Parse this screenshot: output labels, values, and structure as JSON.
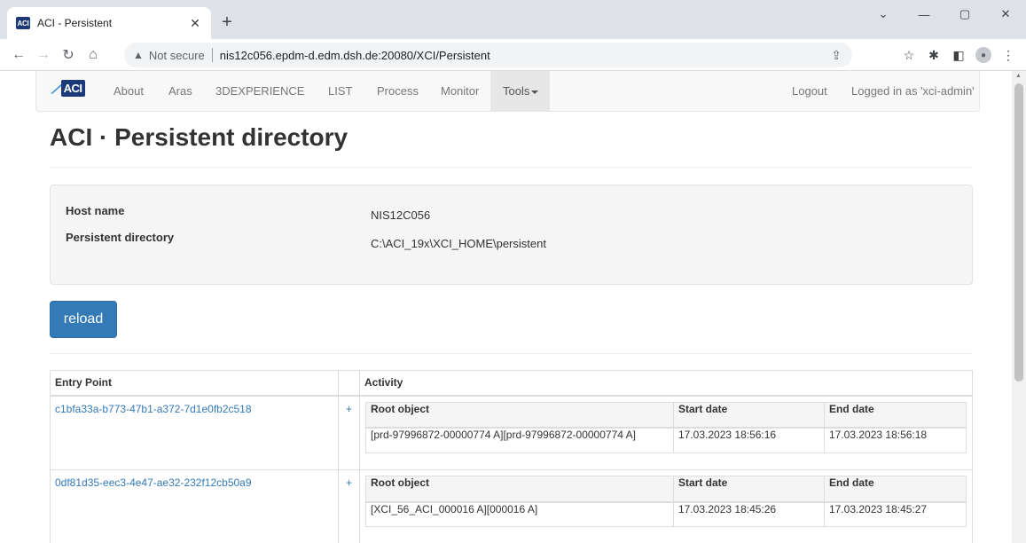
{
  "browser": {
    "tab_title": "ACI - Persistent",
    "favicon_text": "ACI",
    "security_label": "Not secure",
    "url": "nis12c056.epdm-d.edm.dsh.de:20080/XCI/Persistent"
  },
  "navbar": {
    "brand": "ACI",
    "links": [
      "About",
      "Aras",
      "3DEXPERIENCE",
      "LIST",
      "Process",
      "Monitor"
    ],
    "tools_label": "Tools",
    "logout_label": "Logout",
    "logged_in": "Logged in as 'xci-admin'"
  },
  "page": {
    "title_bold": "ACI",
    "title_rest": " · Persistent directory"
  },
  "info": {
    "host_label": "Host name",
    "host_value": "NIS12C056",
    "dir_label": "Persistent directory",
    "dir_value": "C:\\ACI_19x\\XCI_HOME\\persistent"
  },
  "reload_label": "reload",
  "table": {
    "headers": {
      "entry_point": "Entry Point",
      "activity": "Activity"
    },
    "inner_headers": {
      "root": "Root object",
      "start": "Start date",
      "end": "End date"
    },
    "plus_symbol": "+",
    "rows": [
      {
        "entry_point": "c1bfa33a-b773-47b1-a372-7d1e0fb2c518",
        "root": "[prd-97996872-00000774 A][prd-97996872-00000774 A]",
        "start": "17.03.2023 18:56:16",
        "end": "17.03.2023 18:56:18"
      },
      {
        "entry_point": "0df81d35-eec3-4e47-ae32-232f12cb50a9",
        "root": "[XCI_56_ACI_000016 A][000016 A]",
        "start": "17.03.2023 18:45:26",
        "end": "17.03.2023 18:45:27"
      }
    ]
  }
}
